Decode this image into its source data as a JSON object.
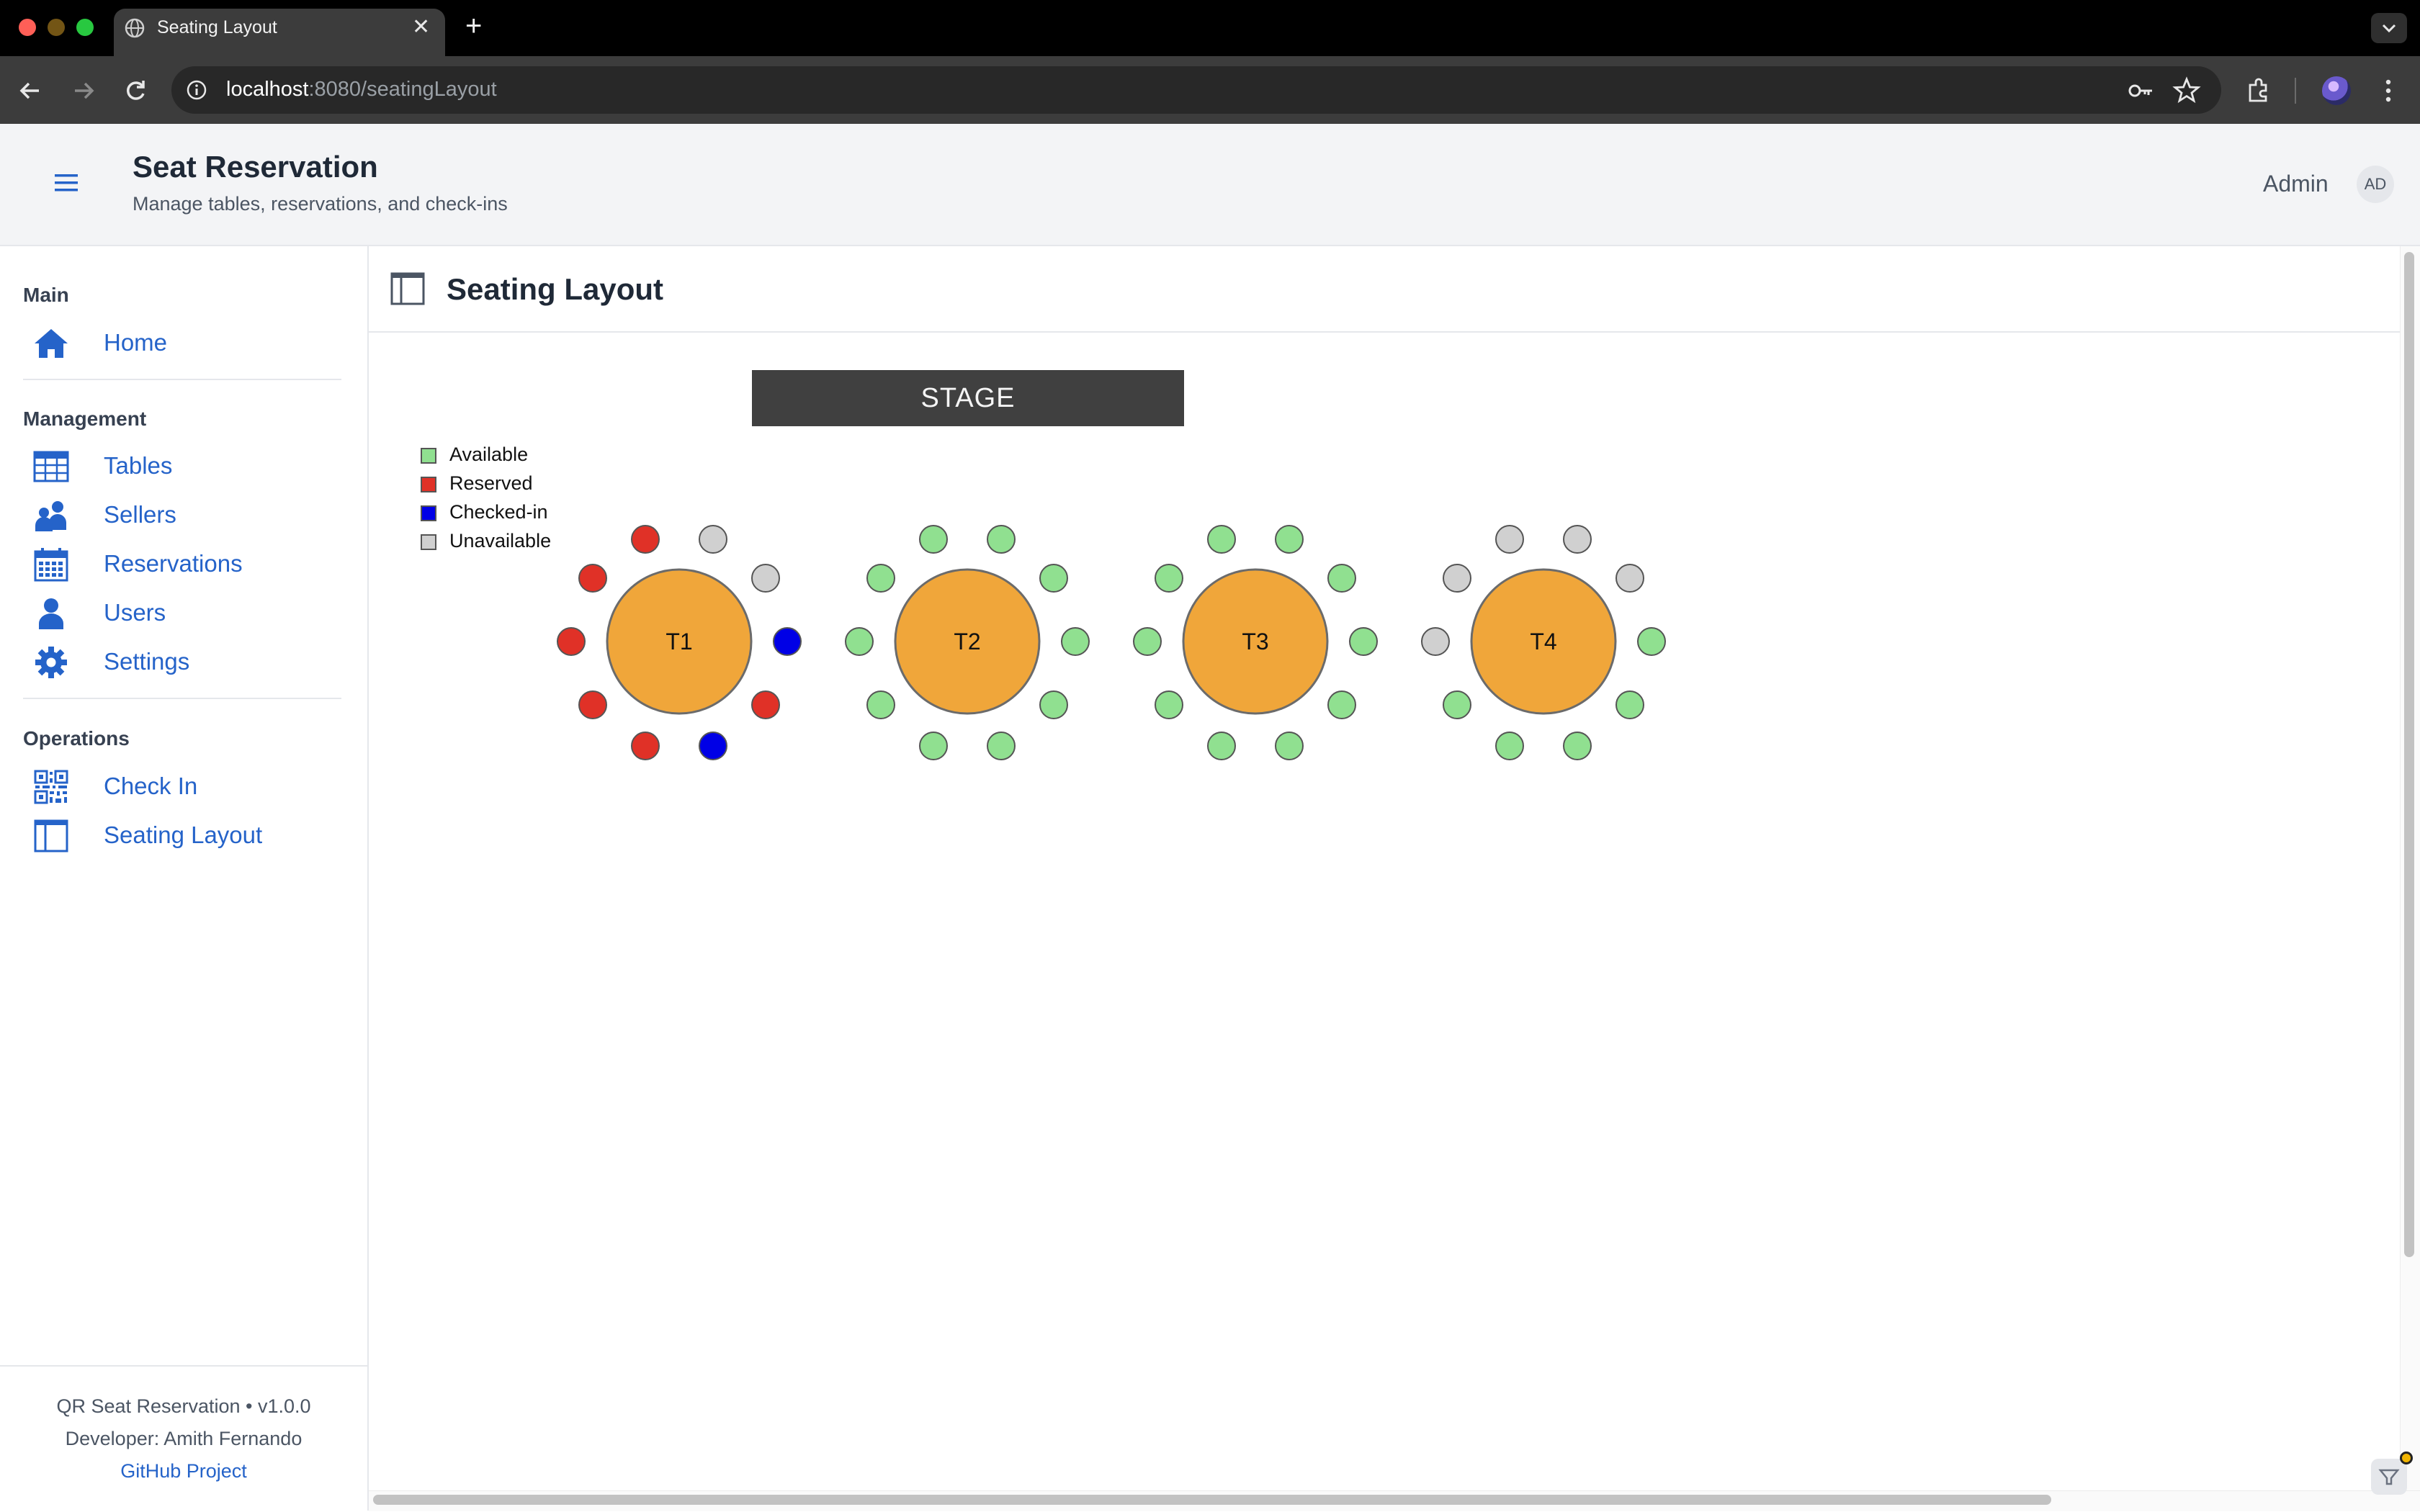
{
  "browser": {
    "tab_title": "Seating Layout",
    "url_host": "localhost",
    "url_path": ":8080/seatingLayout"
  },
  "header": {
    "title": "Seat Reservation",
    "subtitle": "Manage tables, reservations, and check-ins",
    "user_name": "Admin",
    "avatar_initials": "AD"
  },
  "sidebar": {
    "sections": [
      {
        "title": "Main",
        "items": [
          {
            "label": "Home",
            "icon": "home-icon"
          }
        ]
      },
      {
        "title": "Management",
        "items": [
          {
            "label": "Tables",
            "icon": "table-icon"
          },
          {
            "label": "Sellers",
            "icon": "sellers-icon"
          },
          {
            "label": "Reservations",
            "icon": "calendar-icon"
          },
          {
            "label": "Users",
            "icon": "user-icon"
          },
          {
            "label": "Settings",
            "icon": "gear-icon"
          }
        ]
      },
      {
        "title": "Operations",
        "items": [
          {
            "label": "Check In",
            "icon": "qr-code-icon"
          },
          {
            "label": "Seating Layout",
            "icon": "layout-icon"
          }
        ]
      }
    ],
    "footer": {
      "app_version": "QR Seat Reservation • v1.0.0",
      "developer": "Developer: Amith Fernando",
      "link_label": "GitHub Project"
    }
  },
  "main": {
    "title": "Seating Layout",
    "stage_label": "STAGE"
  },
  "legend": [
    {
      "label": "Available",
      "color": "#90e090"
    },
    {
      "label": "Reserved",
      "color": "#e03127"
    },
    {
      "label": "Checked-in",
      "color": "#0000e6"
    },
    {
      "label": "Unavailable",
      "color": "#d0d0d0"
    }
  ],
  "status_colors": {
    "available": "#90e090",
    "reserved": "#e03127",
    "checked-in": "#0000e6",
    "unavailable": "#d0d0d0",
    "table": "#f0a63a"
  },
  "tables": [
    {
      "label": "T1",
      "seats": [
        "reserved",
        "unavailable",
        "unavailable",
        "checked-in",
        "reserved",
        "checked-in",
        "reserved",
        "reserved",
        "reserved",
        "reserved"
      ]
    },
    {
      "label": "T2",
      "seats": [
        "available",
        "available",
        "available",
        "available",
        "available",
        "available",
        "available",
        "available",
        "available",
        "available"
      ]
    },
    {
      "label": "T3",
      "seats": [
        "available",
        "available",
        "available",
        "available",
        "available",
        "available",
        "available",
        "available",
        "available",
        "available"
      ]
    },
    {
      "label": "T4",
      "seats": [
        "unavailable",
        "unavailable",
        "unavailable",
        "available",
        "available",
        "available",
        "available",
        "available",
        "unavailable",
        "unavailable"
      ]
    }
  ]
}
